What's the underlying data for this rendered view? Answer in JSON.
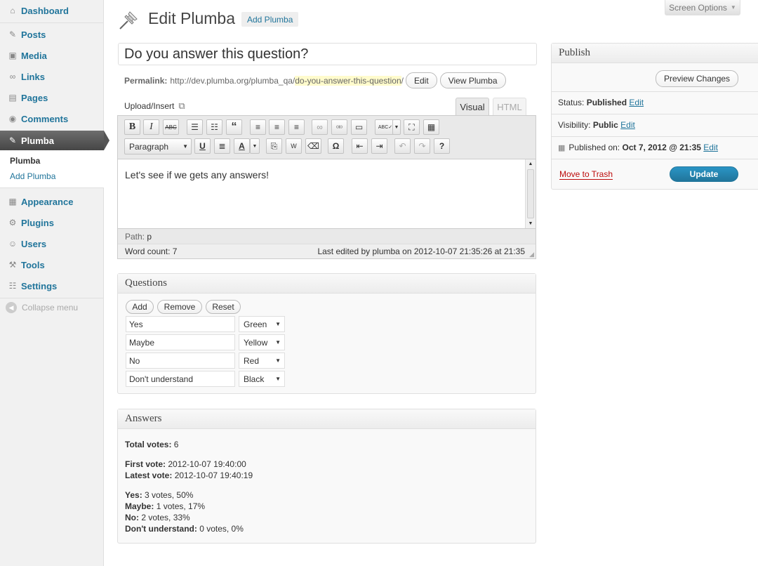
{
  "sidebar": {
    "items": [
      {
        "label": "Dashboard",
        "icon": "dashboard-icon"
      },
      {
        "label": "Posts",
        "icon": "pin-icon"
      },
      {
        "label": "Media",
        "icon": "media-icon"
      },
      {
        "label": "Links",
        "icon": "link-icon"
      },
      {
        "label": "Pages",
        "icon": "pages-icon"
      },
      {
        "label": "Comments",
        "icon": "comment-icon"
      },
      {
        "label": "Plumba",
        "icon": "pin-icon"
      },
      {
        "label": "Appearance",
        "icon": "appearance-icon"
      },
      {
        "label": "Plugins",
        "icon": "plugin-icon"
      },
      {
        "label": "Users",
        "icon": "users-icon"
      },
      {
        "label": "Tools",
        "icon": "tools-icon"
      },
      {
        "label": "Settings",
        "icon": "settings-icon"
      }
    ],
    "submenu": [
      "Plumba",
      "Add Plumba"
    ],
    "collapse": "Collapse menu"
  },
  "header": {
    "screen_options": "Screen Options",
    "title": "Edit Plumba",
    "add_new": "Add Plumba"
  },
  "post": {
    "title": "Do you answer this question?",
    "permalink_label": "Permalink:",
    "permalink_base": "http://dev.plumba.org/plumba_qa/",
    "permalink_slug": "do-you-answer-this-question",
    "permalink_end": "/",
    "edit_button": "Edit",
    "view_button": "View Plumba"
  },
  "editor": {
    "upload_insert": "Upload/Insert",
    "tab_visual": "Visual",
    "tab_html": "HTML",
    "format": "Paragraph",
    "content": "Let's see if we gets any answers!",
    "path_label": "Path:",
    "path_value": "p",
    "word_count": "Word count: 7",
    "last_edited": "Last edited by plumba on 2012-10-07 21:35:26 at 21:35"
  },
  "questions": {
    "title": "Questions",
    "add": "Add",
    "remove": "Remove",
    "reset": "Reset",
    "rows": [
      {
        "answer": "Yes",
        "color": "Green"
      },
      {
        "answer": "Maybe",
        "color": "Yellow"
      },
      {
        "answer": "No",
        "color": "Red"
      },
      {
        "answer": "Don't understand",
        "color": "Black"
      }
    ]
  },
  "answers": {
    "title": "Answers",
    "total_label": "Total votes:",
    "total_value": "6",
    "first_label": "First vote:",
    "first_value": "2012-10-07 19:40:00",
    "latest_label": "Latest vote:",
    "latest_value": "2012-10-07 19:40:19",
    "results": [
      {
        "label": "Yes:",
        "value": "3 votes, 50%"
      },
      {
        "label": "Maybe:",
        "value": "1 votes, 17%"
      },
      {
        "label": "No:",
        "value": "2 votes, 33%"
      },
      {
        "label": "Don't understand:",
        "value": "0 votes, 0%"
      }
    ]
  },
  "publish": {
    "title": "Publish",
    "preview": "Preview Changes",
    "status_label": "Status:",
    "status_value": "Published",
    "visibility_label": "Visibility:",
    "visibility_value": "Public",
    "published_label": "Published on:",
    "published_value": "Oct 7, 2012 @ 21:35",
    "edit": "Edit",
    "trash": "Move to Trash",
    "update": "Update"
  },
  "colors": {
    "link": "#21759b",
    "trash": "#bc0b0b",
    "permalink_highlight": "#fffbcc"
  }
}
